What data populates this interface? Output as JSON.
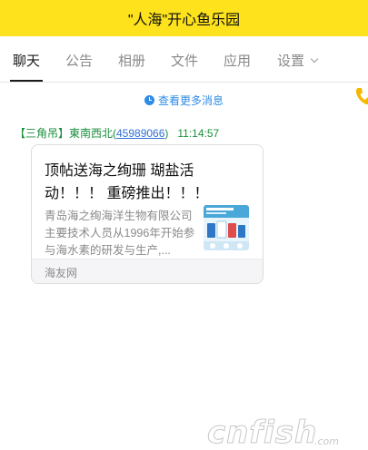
{
  "window": {
    "title": "\"人海\"开心鱼乐园"
  },
  "tabs": [
    {
      "label": "聊天",
      "active": true
    },
    {
      "label": "公告",
      "active": false
    },
    {
      "label": "相册",
      "active": false
    },
    {
      "label": "文件",
      "active": false
    },
    {
      "label": "应用",
      "active": false
    },
    {
      "label": "设置",
      "active": false
    }
  ],
  "history_link": {
    "label": "查看更多消息",
    "color": "#2f8be6"
  },
  "message": {
    "sender_prefix": "【三角吊】東南西北(",
    "sender_id": "45989066",
    "sender_suffix": ")",
    "time": "11:14:57",
    "card": {
      "title": "顶帖送海之绚珊 瑚盐活动！！！ 重磅推出！！！",
      "description": "青岛海之绚海洋生物有限公司主要技术人员从1996年开始参与海水素的研发与生产,...",
      "source": "海友网",
      "thumbnail_icon": "product-thumbnail-image"
    }
  },
  "watermark": {
    "text": "cnfish.com"
  },
  "colors": {
    "titlebar_bg": "#fde21c",
    "sender_green": "#1a8f3c",
    "link_blue": "#2f6fd6",
    "phone_icon": "#f5b800"
  }
}
